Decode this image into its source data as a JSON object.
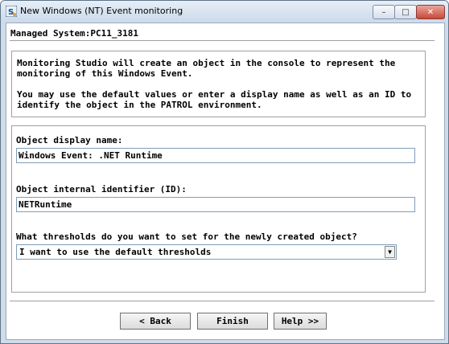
{
  "window": {
    "title": "New Windows (NT) Event monitoring",
    "minimize_glyph": "–",
    "maximize_glyph": "□",
    "close_glyph": "✕"
  },
  "header": {
    "managed_system": "Managed System:PC11_3181"
  },
  "info": {
    "paragraph1": "Monitoring Studio will create an object in the console to represent the monitoring of this Windows Event.",
    "paragraph2": "You may use the default values or enter a display name as well as an ID to identify the object in the PATROL environment."
  },
  "form": {
    "display_name_label": "Object display name:",
    "display_name_value": "Windows Event: .NET Runtime",
    "internal_id_label": "Object internal identifier (ID):",
    "internal_id_value": "NETRuntime",
    "thresholds_label": "What thresholds do you want to set for the newly created object?",
    "thresholds_selected": "I want to use the default thresholds"
  },
  "buttons": {
    "back": "< Back",
    "finish": "Finish",
    "help": "Help >>"
  },
  "colors": {
    "window_frame": "#cfdcea",
    "close_button": "#c9483a",
    "field_border": "#7f9db9"
  }
}
